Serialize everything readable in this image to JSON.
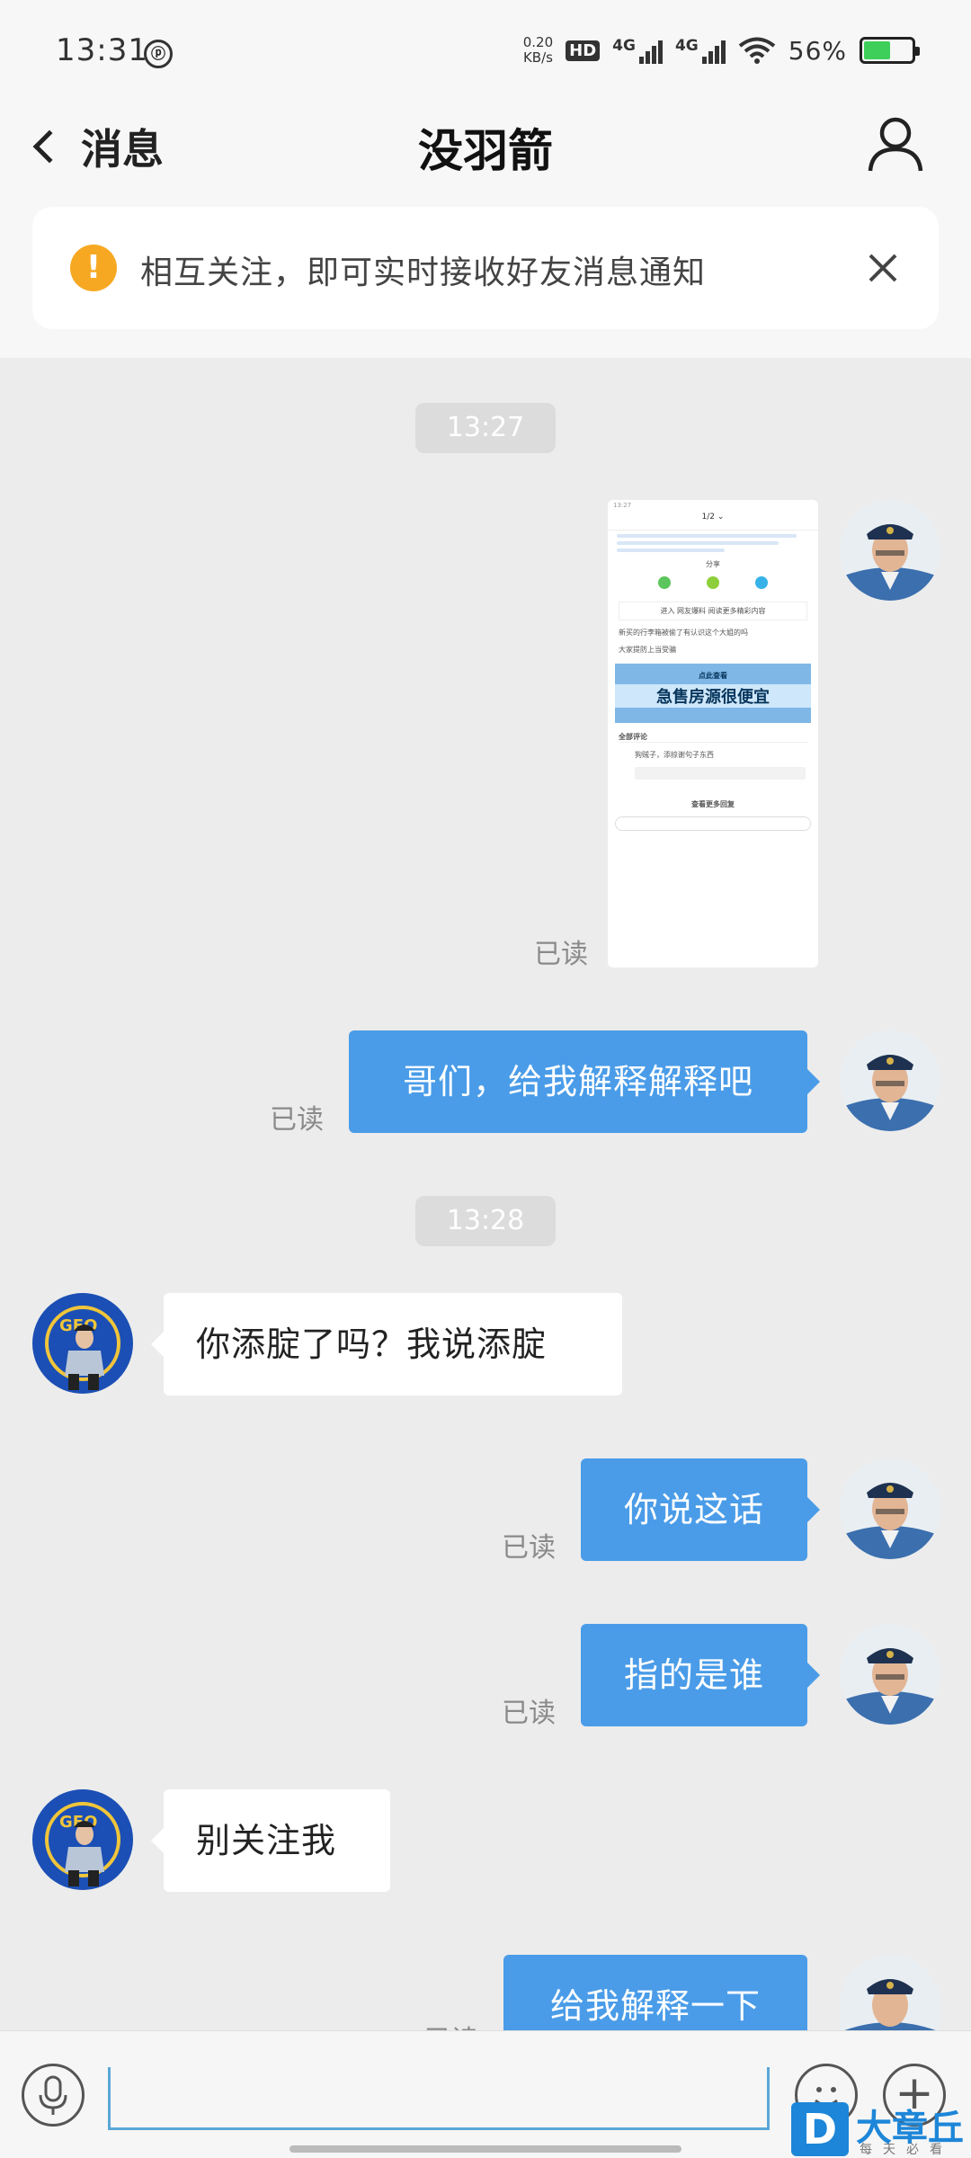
{
  "status_bar": {
    "time": "13:31",
    "net_speed_value": "0.20",
    "net_speed_unit": "KB/s",
    "hd_label": "HD",
    "sim1_label": "4G",
    "sim2_label": "4G",
    "battery_pct": "56%",
    "battery_level": 0.56
  },
  "header": {
    "back_label": "消息",
    "title": "没羽箭"
  },
  "notice": {
    "icon": "!",
    "text": "相互关注，即可实时接收好友消息通知"
  },
  "thumb": {
    "nav": "1/2",
    "share_label": "分享",
    "link_text": "进入 网友爆料 阅读更多精彩内容",
    "post_text": "新买的行李箱被偷了有认识这个大姐的吗",
    "post_text2": "大家提防上当受骗",
    "banner_top": "点此查看",
    "banner_main": "急售房源很便宜",
    "comments_label": "全部评论",
    "comment_text": "狗贼子，添掠谢句子东西",
    "more_label": "查看更多回复"
  },
  "messages": [
    {
      "type": "time",
      "text": "13:27"
    },
    {
      "type": "image",
      "side": "me",
      "read": "已读"
    },
    {
      "type": "text",
      "side": "me",
      "text": "哥们，给我解释解释吧",
      "read": "已读"
    },
    {
      "type": "time",
      "text": "13:28"
    },
    {
      "type": "text",
      "side": "them",
      "text": "你添腚了吗？我说添腚"
    },
    {
      "type": "text",
      "side": "me",
      "text": "你说这话",
      "read": "已读"
    },
    {
      "type": "text",
      "side": "me",
      "text": "指的是谁",
      "read": "已读"
    },
    {
      "type": "text",
      "side": "them",
      "text": "别关注我"
    },
    {
      "type": "text",
      "side": "me",
      "text": "给我解释一下",
      "read": "已读"
    }
  ],
  "input_bar": {
    "plus_label": "+"
  },
  "watermark": {
    "logo": "D",
    "brand": "大章丘",
    "slogan": "每天必看"
  },
  "colors": {
    "accent": "#4a9ce8",
    "warn": "#f7a823",
    "battery": "#3ecf5a"
  }
}
